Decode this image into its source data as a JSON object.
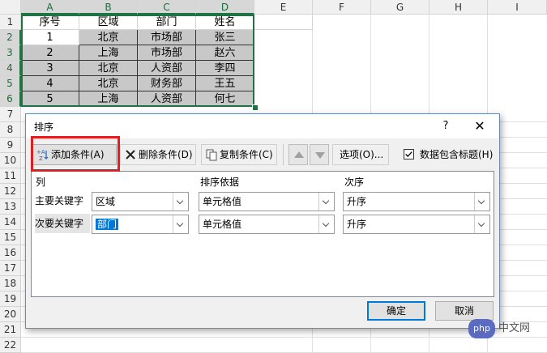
{
  "sheet": {
    "columns": [
      "A",
      "B",
      "C",
      "D",
      "E",
      "F",
      "G",
      "H",
      "I"
    ],
    "rows": [
      "1",
      "2",
      "3",
      "4",
      "5",
      "6",
      "7",
      "8",
      "9",
      "10",
      "11",
      "12",
      "13",
      "14",
      "15",
      "16",
      "17",
      "18",
      "19",
      "20",
      "21",
      "22"
    ],
    "headers": [
      "序号",
      "区域",
      "部门",
      "姓名"
    ],
    "data": [
      [
        "1",
        "北京",
        "市场部",
        "张三"
      ],
      [
        "2",
        "上海",
        "市场部",
        "赵六"
      ],
      [
        "3",
        "北京",
        "人资部",
        "李四"
      ],
      [
        "4",
        "北京",
        "财务部",
        "王五"
      ],
      [
        "5",
        "上海",
        "人资部",
        "何七"
      ]
    ]
  },
  "dialog": {
    "title": "排序",
    "help": "?",
    "close": "✕",
    "toolbar": {
      "add": "添加条件(A)",
      "delete": "删除条件(D)",
      "copy": "复制条件(C)",
      "options": "选项(O)...",
      "has_header": "数据包含标题(H)",
      "has_header_checked": true
    },
    "list": {
      "col_header": "列",
      "sortby_header": "排序依据",
      "order_header": "次序",
      "rows": [
        {
          "label": "主要关键字",
          "column": "区域",
          "sortby": "单元格值",
          "order": "升序"
        },
        {
          "label": "次要关键字",
          "column": "部门",
          "sortby": "单元格值",
          "order": "升序"
        }
      ]
    },
    "ok": "确定",
    "cancel": "取消"
  },
  "watermark": {
    "logo": "php",
    "text": "中文网"
  }
}
